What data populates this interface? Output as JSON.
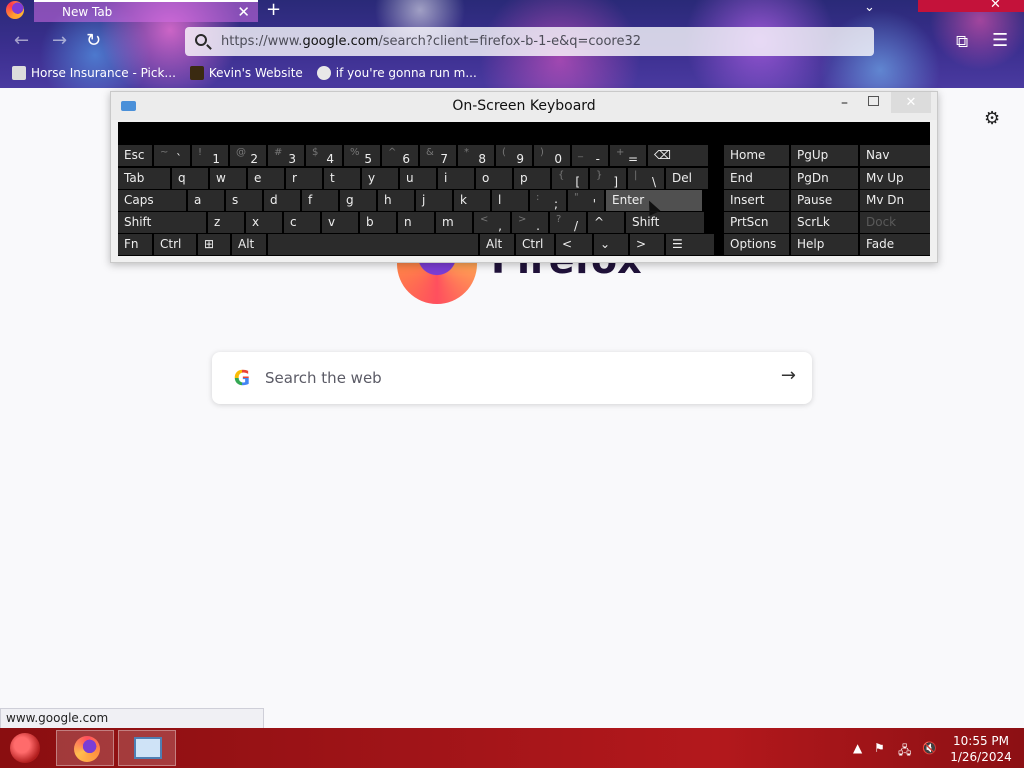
{
  "browser": {
    "tab_title": "New Tab",
    "tab_close": "✕",
    "new_tab": "+",
    "tab_list": "⌄",
    "close_window": "✕",
    "url_prefix": "https://www.",
    "url_host": "google.com",
    "url_suffix": "/search?client=firefox-b-1-e&q=coore32",
    "bookmarks": [
      {
        "label": "Horse Insurance - Pick..."
      },
      {
        "label": "Kevin's Website"
      },
      {
        "label": "if you're gonna run m..."
      }
    ]
  },
  "page": {
    "wordmark": "Firefox",
    "search_placeholder": "Search the web",
    "google_letter": "G",
    "go_arrow": "→",
    "settings_icon": "⚙",
    "status_url": "www.google.com"
  },
  "osk": {
    "title": "On-Screen Keyboard",
    "min": "–",
    "close": "✕",
    "row1": [
      {
        "main": "Esc"
      },
      {
        "alt": "~",
        "main": "`"
      },
      {
        "alt": "!",
        "main": "1"
      },
      {
        "alt": "@",
        "main": "2"
      },
      {
        "alt": "#",
        "main": "3"
      },
      {
        "alt": "$",
        "main": "4"
      },
      {
        "alt": "%",
        "main": "5"
      },
      {
        "alt": "^",
        "main": "6"
      },
      {
        "alt": "&",
        "main": "7"
      },
      {
        "alt": "*",
        "main": "8"
      },
      {
        "alt": "(",
        "main": "9"
      },
      {
        "alt": ")",
        "main": "0"
      },
      {
        "alt": "_",
        "main": "-"
      },
      {
        "alt": "+",
        "main": "="
      },
      {
        "main": "⌫"
      }
    ],
    "row2": [
      {
        "main": "Tab"
      },
      {
        "main": "q"
      },
      {
        "main": "w"
      },
      {
        "main": "e"
      },
      {
        "main": "r"
      },
      {
        "main": "t"
      },
      {
        "main": "y"
      },
      {
        "main": "u"
      },
      {
        "main": "i"
      },
      {
        "main": "o"
      },
      {
        "main": "p"
      },
      {
        "alt": "{",
        "main": "["
      },
      {
        "alt": "}",
        "main": "]"
      },
      {
        "alt": "|",
        "main": "\\"
      },
      {
        "main": "Del"
      }
    ],
    "row3": [
      {
        "main": "Caps"
      },
      {
        "main": "a"
      },
      {
        "main": "s"
      },
      {
        "main": "d"
      },
      {
        "main": "f"
      },
      {
        "main": "g"
      },
      {
        "main": "h"
      },
      {
        "main": "j"
      },
      {
        "main": "k"
      },
      {
        "main": "l"
      },
      {
        "alt": ":",
        "main": ";"
      },
      {
        "alt": "\"",
        "main": "'"
      },
      {
        "main": "Enter"
      }
    ],
    "row4": [
      {
        "main": "Shift"
      },
      {
        "main": "z"
      },
      {
        "main": "x"
      },
      {
        "main": "c"
      },
      {
        "main": "v"
      },
      {
        "main": "b"
      },
      {
        "main": "n"
      },
      {
        "main": "m"
      },
      {
        "alt": "<",
        "main": ","
      },
      {
        "alt": ">",
        "main": "."
      },
      {
        "alt": "?",
        "main": "/"
      },
      {
        "main": "^"
      },
      {
        "main": "Shift"
      }
    ],
    "row5": [
      {
        "main": "Fn"
      },
      {
        "main": "Ctrl"
      },
      {
        "main": "⊞"
      },
      {
        "main": "Alt"
      },
      {
        "main": ""
      },
      {
        "main": "Alt"
      },
      {
        "main": "Ctrl"
      },
      {
        "main": "<"
      },
      {
        "main": "⌄"
      },
      {
        "main": ">"
      },
      {
        "main": "☰"
      }
    ],
    "nav": [
      [
        "Home",
        "PgUp",
        "Nav"
      ],
      [
        "End",
        "PgDn",
        "Mv Up"
      ],
      [
        "Insert",
        "Pause",
        "Mv Dn"
      ],
      [
        "PrtScn",
        "ScrLk",
        "Dock"
      ],
      [
        "Options",
        "Help",
        "Fade"
      ]
    ]
  },
  "taskbar": {
    "time": "10:55 PM",
    "date": "1/26/2024",
    "tray_up": "▲",
    "tray_flag": "⚑",
    "tray_net": "🖧",
    "tray_vol": "🔇"
  }
}
